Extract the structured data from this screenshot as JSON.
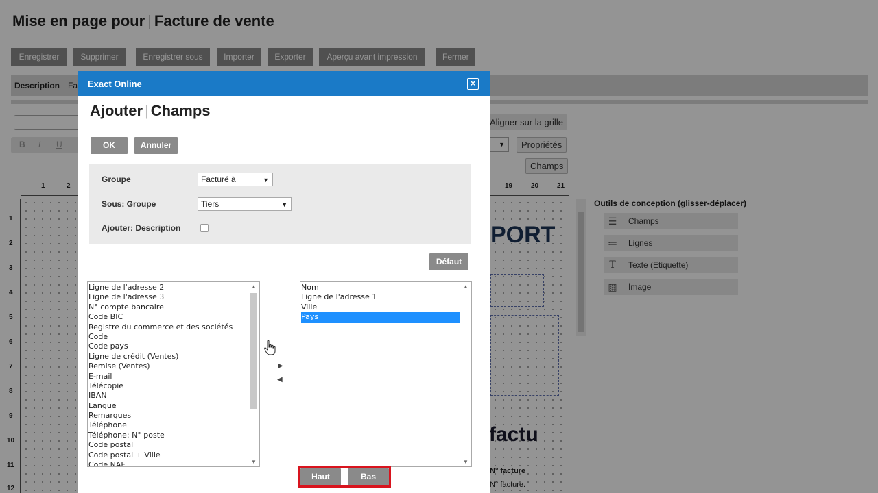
{
  "page": {
    "title_part1": "Mise en page pour",
    "title_sep": "|",
    "title_part2": "Facture de vente"
  },
  "toolbar": {
    "save": "Enregistrer",
    "delete": "Supprimer",
    "save_as": "Enregistrer sous",
    "import": "Importer",
    "export": "Exporter",
    "print_preview": "Aperçu avant impression",
    "close": "Fermer"
  },
  "description": {
    "label": "Description",
    "value": "Fa"
  },
  "right_buttons": {
    "align_grid": "Aligner sur la grille",
    "properties": "Propriétés",
    "fields": "Champs"
  },
  "format": {
    "bold": "B",
    "italic": "I",
    "underline": "U"
  },
  "ruler": {
    "top": [
      "1",
      "2",
      "19",
      "20",
      "21"
    ],
    "left": [
      "1",
      "2",
      "3",
      "4",
      "5",
      "6",
      "7",
      "8",
      "9",
      "10",
      "11",
      "12"
    ]
  },
  "canvas": {
    "big_text_1": "PORT",
    "big_text_2": "factu",
    "invoice_no_1": "N° facture",
    "invoice_no_2": "N° facture."
  },
  "design_tools": {
    "title": "Outils de conception (glisser-déplacer)",
    "items": [
      {
        "label": "Champs",
        "icon": "fields-icon"
      },
      {
        "label": "Lignes",
        "icon": "lines-icon"
      },
      {
        "label": "Texte (Etiquette)",
        "icon": "text-icon"
      },
      {
        "label": "Image",
        "icon": "image-icon"
      }
    ]
  },
  "dialog": {
    "header": "Exact Online",
    "title_part1": "Ajouter",
    "title_sep": "|",
    "title_part2": "Champs",
    "ok": "OK",
    "cancel": "Annuler",
    "group_label": "Groupe",
    "group_value": "Facturé à",
    "subgroup_label": "Sous: Groupe",
    "subgroup_value": "Tiers",
    "add_desc_label": "Ajouter: Description",
    "default": "Défaut",
    "available": [
      "Ligne de l'adresse 2",
      "Ligne de l'adresse 3",
      "N° compte bancaire",
      "Code BIC",
      "Registre du commerce et des sociétés",
      "Code",
      "Code pays",
      "Ligne de crédit (Ventes)",
      "Remise (Ventes)",
      "E-mail",
      "Télécopie",
      "IBAN",
      "Langue",
      "Remarques",
      "Téléphone",
      "Téléphone: N° poste",
      "Code postal",
      "Code postal + Ville",
      "Code NAF"
    ],
    "selected": [
      "Nom",
      "Ligne de l'adresse 1",
      "Ville",
      "Pays"
    ],
    "selected_highlight": "Pays",
    "up": "Haut",
    "down": "Bas"
  },
  "colors": {
    "header_blue": "#1a7ac7",
    "button_gray": "#8a8a8a",
    "selection_blue": "#1e90ff",
    "highlight_red": "#d8141e"
  }
}
